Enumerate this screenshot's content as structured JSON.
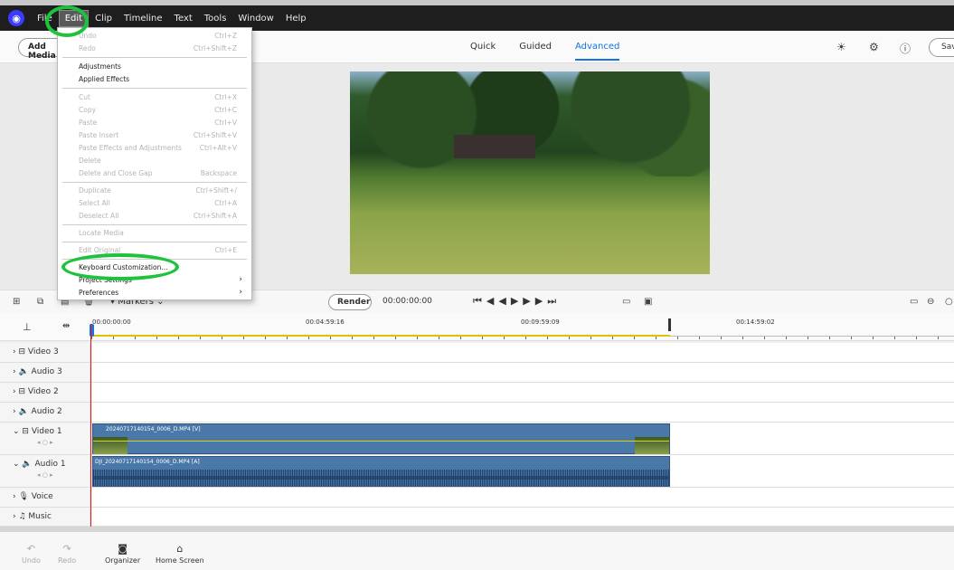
{
  "menubar": {
    "items": [
      "File",
      "Edit",
      "Clip",
      "Timeline",
      "Text",
      "Tools",
      "Window",
      "Help"
    ]
  },
  "toolbar": {
    "add_media": "Add Media",
    "modes": [
      "Quick",
      "Guided",
      "Advanced"
    ],
    "selected_mode": "Advanced",
    "save": "Save"
  },
  "edit_menu": {
    "items": [
      {
        "label": "Undo",
        "shortcut": "Ctrl+Z",
        "enabled": false
      },
      {
        "label": "Redo",
        "shortcut": "Ctrl+Shift+Z",
        "enabled": false
      },
      {
        "label": "Adjustments",
        "shortcut": "",
        "enabled": true
      },
      {
        "label": "Applied Effects",
        "shortcut": "",
        "enabled": true
      },
      {
        "label": "Cut",
        "shortcut": "Ctrl+X",
        "enabled": false
      },
      {
        "label": "Copy",
        "shortcut": "Ctrl+C",
        "enabled": false
      },
      {
        "label": "Paste",
        "shortcut": "Ctrl+V",
        "enabled": false
      },
      {
        "label": "Paste Insert",
        "shortcut": "Ctrl+Shift+V",
        "enabled": false
      },
      {
        "label": "Paste Effects and Adjustments",
        "shortcut": "Ctrl+Alt+V",
        "enabled": false
      },
      {
        "label": "Delete",
        "shortcut": "",
        "enabled": false
      },
      {
        "label": "Delete and Close Gap",
        "shortcut": "Backspace",
        "enabled": false
      },
      {
        "label": "Duplicate",
        "shortcut": "Ctrl+Shift+/",
        "enabled": false
      },
      {
        "label": "Select All",
        "shortcut": "Ctrl+A",
        "enabled": false
      },
      {
        "label": "Deselect All",
        "shortcut": "Ctrl+Shift+A",
        "enabled": false
      },
      {
        "label": "Locate Media",
        "shortcut": "",
        "enabled": false
      },
      {
        "label": "Edit Original",
        "shortcut": "Ctrl+E",
        "enabled": false
      },
      {
        "label": "Keyboard Customization...",
        "shortcut": "",
        "enabled": true
      },
      {
        "label": "Project Settings",
        "shortcut": "",
        "enabled": true
      },
      {
        "label": "Preferences",
        "shortcut": "",
        "enabled": true
      }
    ]
  },
  "controls": {
    "markers": "Markers",
    "render": "Render",
    "timecode": "00:00:00:00"
  },
  "ruler": {
    "times": [
      "00:00:00:00",
      "00:04:59:16",
      "00:09:59:09",
      "00:14:59:02"
    ]
  },
  "tracks": [
    {
      "name": "Video 3",
      "type": "video"
    },
    {
      "name": "Audio 3",
      "type": "audio"
    },
    {
      "name": "Video 2",
      "type": "video"
    },
    {
      "name": "Audio 2",
      "type": "audio"
    },
    {
      "name": "Video 1",
      "type": "video"
    },
    {
      "name": "Audio 1",
      "type": "audio"
    },
    {
      "name": "Voice",
      "type": "voice"
    },
    {
      "name": "Music",
      "type": "music"
    }
  ],
  "clips": {
    "video_label": "20240717140154_0006_D.MP4 [V]",
    "audio_label": "DJI_20240717140154_0006_D.MP4 [A]"
  },
  "bottombar": {
    "undo": "Undo",
    "redo": "Redo",
    "organizer": "Organizer",
    "home": "Home Screen"
  }
}
